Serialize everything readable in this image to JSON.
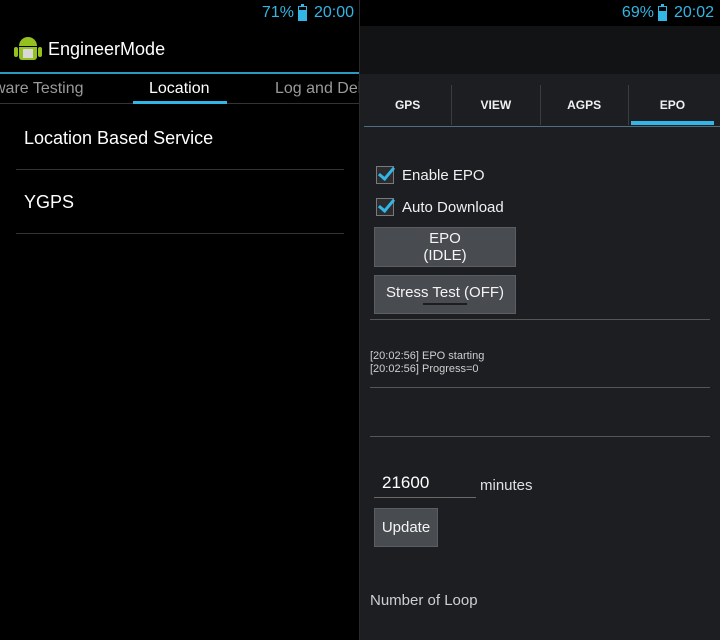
{
  "left": {
    "status": {
      "battery_pct": "71%",
      "battery_level": 0.71,
      "time": "20:00"
    },
    "app_title": "EngineerMode",
    "tabs": [
      {
        "label": "ware Testing",
        "active": false
      },
      {
        "label": "Location",
        "active": true
      },
      {
        "label": "Log and Del",
        "active": false
      }
    ],
    "list": [
      {
        "label": "Location Based Service"
      },
      {
        "label": "YGPS"
      }
    ]
  },
  "right": {
    "status": {
      "battery_pct": "69%",
      "battery_level": 0.69,
      "time": "20:02"
    },
    "tabs": [
      {
        "label": "GPS",
        "active": false
      },
      {
        "label": "VIEW",
        "active": false
      },
      {
        "label": "AGPS",
        "active": false
      },
      {
        "label": "EPO",
        "active": true
      }
    ],
    "enable_epo": {
      "label": "Enable EPO",
      "checked": true
    },
    "auto_download": {
      "label": "Auto Download",
      "checked": true
    },
    "epo_button": {
      "line1": "EPO",
      "line2": "(IDLE)"
    },
    "stress_button": {
      "label": "Stress Test (OFF)"
    },
    "log": [
      "[20:02:56] EPO starting",
      "[20:02:56] Progress=0"
    ],
    "interval": {
      "value": "21600",
      "units": "minutes"
    },
    "update_button": {
      "label": "Update"
    },
    "loop_label": "Number of Loop"
  },
  "colors": {
    "accent": "#33b5e5",
    "android_green": "#94c020"
  },
  "icons": [
    "battery-icon",
    "android-app-icon",
    "checkbox-checked-icon"
  ]
}
